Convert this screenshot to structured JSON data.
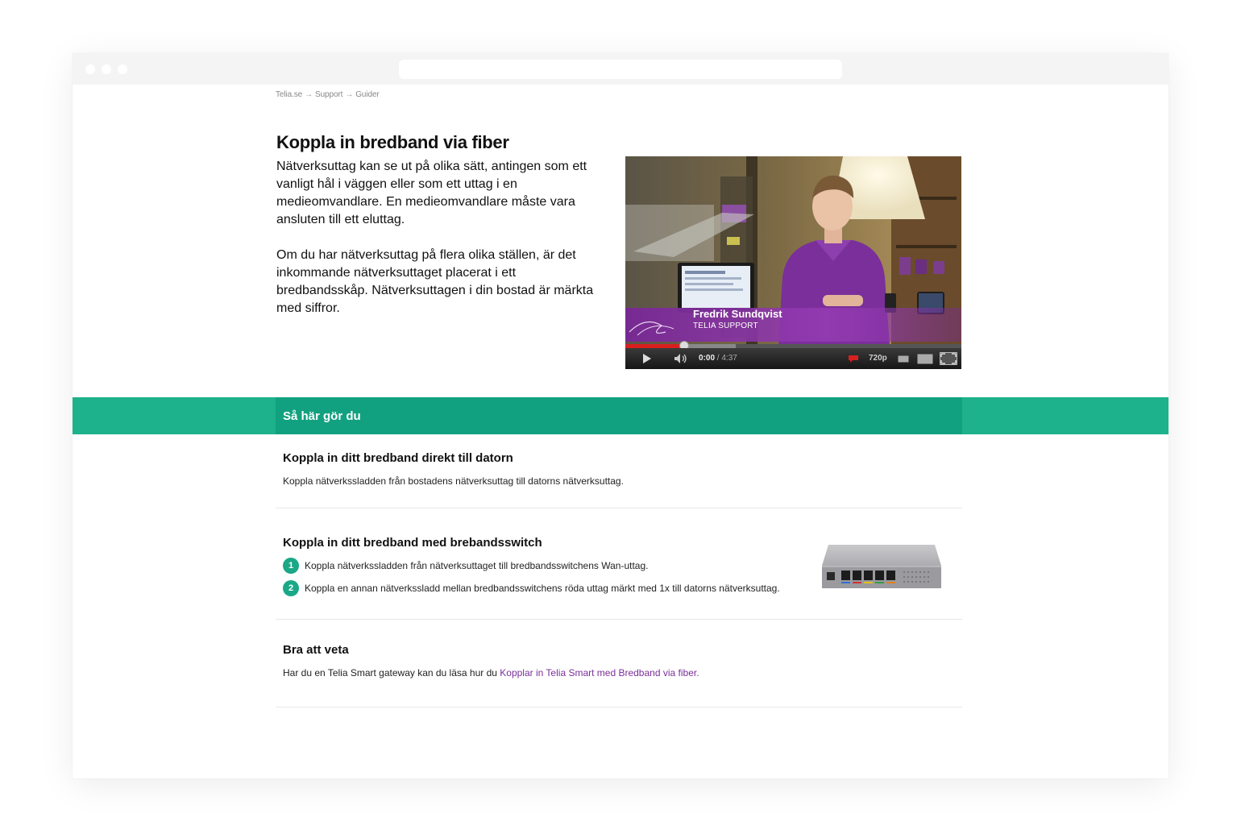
{
  "breadcrumb": {
    "items": [
      "Telia.se",
      "Support",
      "Guider"
    ]
  },
  "article": {
    "title": "Koppla in bredband via fiber",
    "paragraphs": [
      "Nätverksuttag kan se ut på olika sätt, antingen som ett vanligt hål i väggen eller som ett uttag i en medieomvandlare. En medieomvandlare måste vara ansluten till ett eluttag.",
      "Om du har nätverksuttag på flera olika ställen, är det inkommande nätverksuttaget placerat i ett bredbandsskåp. Nätverksuttagen i din bostad är märkta med siffror."
    ]
  },
  "video": {
    "presenter_name": "Fredrik Sundqvist",
    "presenter_role": "TELIA SUPPORT",
    "current_time": "0:00",
    "duration": "/ 4:37",
    "quality": "720p",
    "played_fraction": 0.0,
    "icons": [
      "play-icon",
      "volume-icon",
      "annotations-icon",
      "small-player-icon",
      "large-player-icon",
      "fullscreen-icon"
    ]
  },
  "steps_header": "Så här gör du",
  "sections": {
    "direct": {
      "title": "Koppla in ditt bredband direkt till datorn",
      "body": "Koppla nätverkssladden från bostadens nätverksuttag till datorns nätverksuttag."
    },
    "switch": {
      "title": "Koppla in ditt bredband med brebandsswitch",
      "steps": [
        {
          "number": "1",
          "text": "Koppla nätverkssladden från nätverksuttaget till bredbandsswitchens Wan-uttag."
        },
        {
          "number": "2",
          "text": "Koppla en annan nätverkssladd mellan bredbandsswitchens röda uttag märkt med 1x till datorns nätverksuttag."
        }
      ]
    },
    "good_to_know": {
      "title": "Bra att veta",
      "body_prefix": "Har du en Telia Smart gateway kan du läsa hur du ",
      "link_text": "Kopplar in Telia Smart med Bredband via fiber."
    }
  },
  "colors": {
    "accent_green": "#1db28b",
    "accent_green_dark": "#12a180",
    "link_purple": "#7a2f9a",
    "brand_purple": "#8a3aa8"
  }
}
